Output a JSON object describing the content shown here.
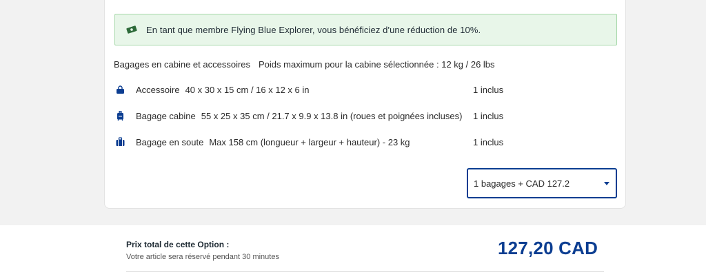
{
  "promo": {
    "text": "En tant que membre Flying Blue Explorer, vous bénéficiez d'une réduction de 10%."
  },
  "baggage": {
    "header_title": "Bagages en cabine et accessoires",
    "header_weight": "Poids maximum pour la cabine sélectionnée : 12 kg / 26 lbs",
    "items": [
      {
        "name": "Accessoire",
        "dimensions": "40 x 30 x 15 cm / 16 x 12 x 6 in",
        "included": "1 inclus",
        "icon": "bag-icon"
      },
      {
        "name": "Bagage cabine",
        "dimensions": "55 x 25 x 35 cm / 21.7 x 9.9 x 13.8 in (roues et poignées incluses)",
        "included": "1 inclus",
        "icon": "cabin-bag-icon"
      },
      {
        "name": "Bagage en soute",
        "dimensions": "Max 158 cm (longueur + largeur + hauteur) - 23 kg",
        "included": "1 inclus",
        "icon": "suitcase-icon"
      }
    ],
    "select_value": "1 bagages + CAD 127.2"
  },
  "footer": {
    "title": "Prix total de cette Option :",
    "subtitle": "Votre article sera réservé pendant 30 minutes",
    "price": "127,20 CAD"
  },
  "colors": {
    "brand": "#0b3d91",
    "promo_bg": "#e8f6e9",
    "promo_border": "#a6d8a9"
  }
}
